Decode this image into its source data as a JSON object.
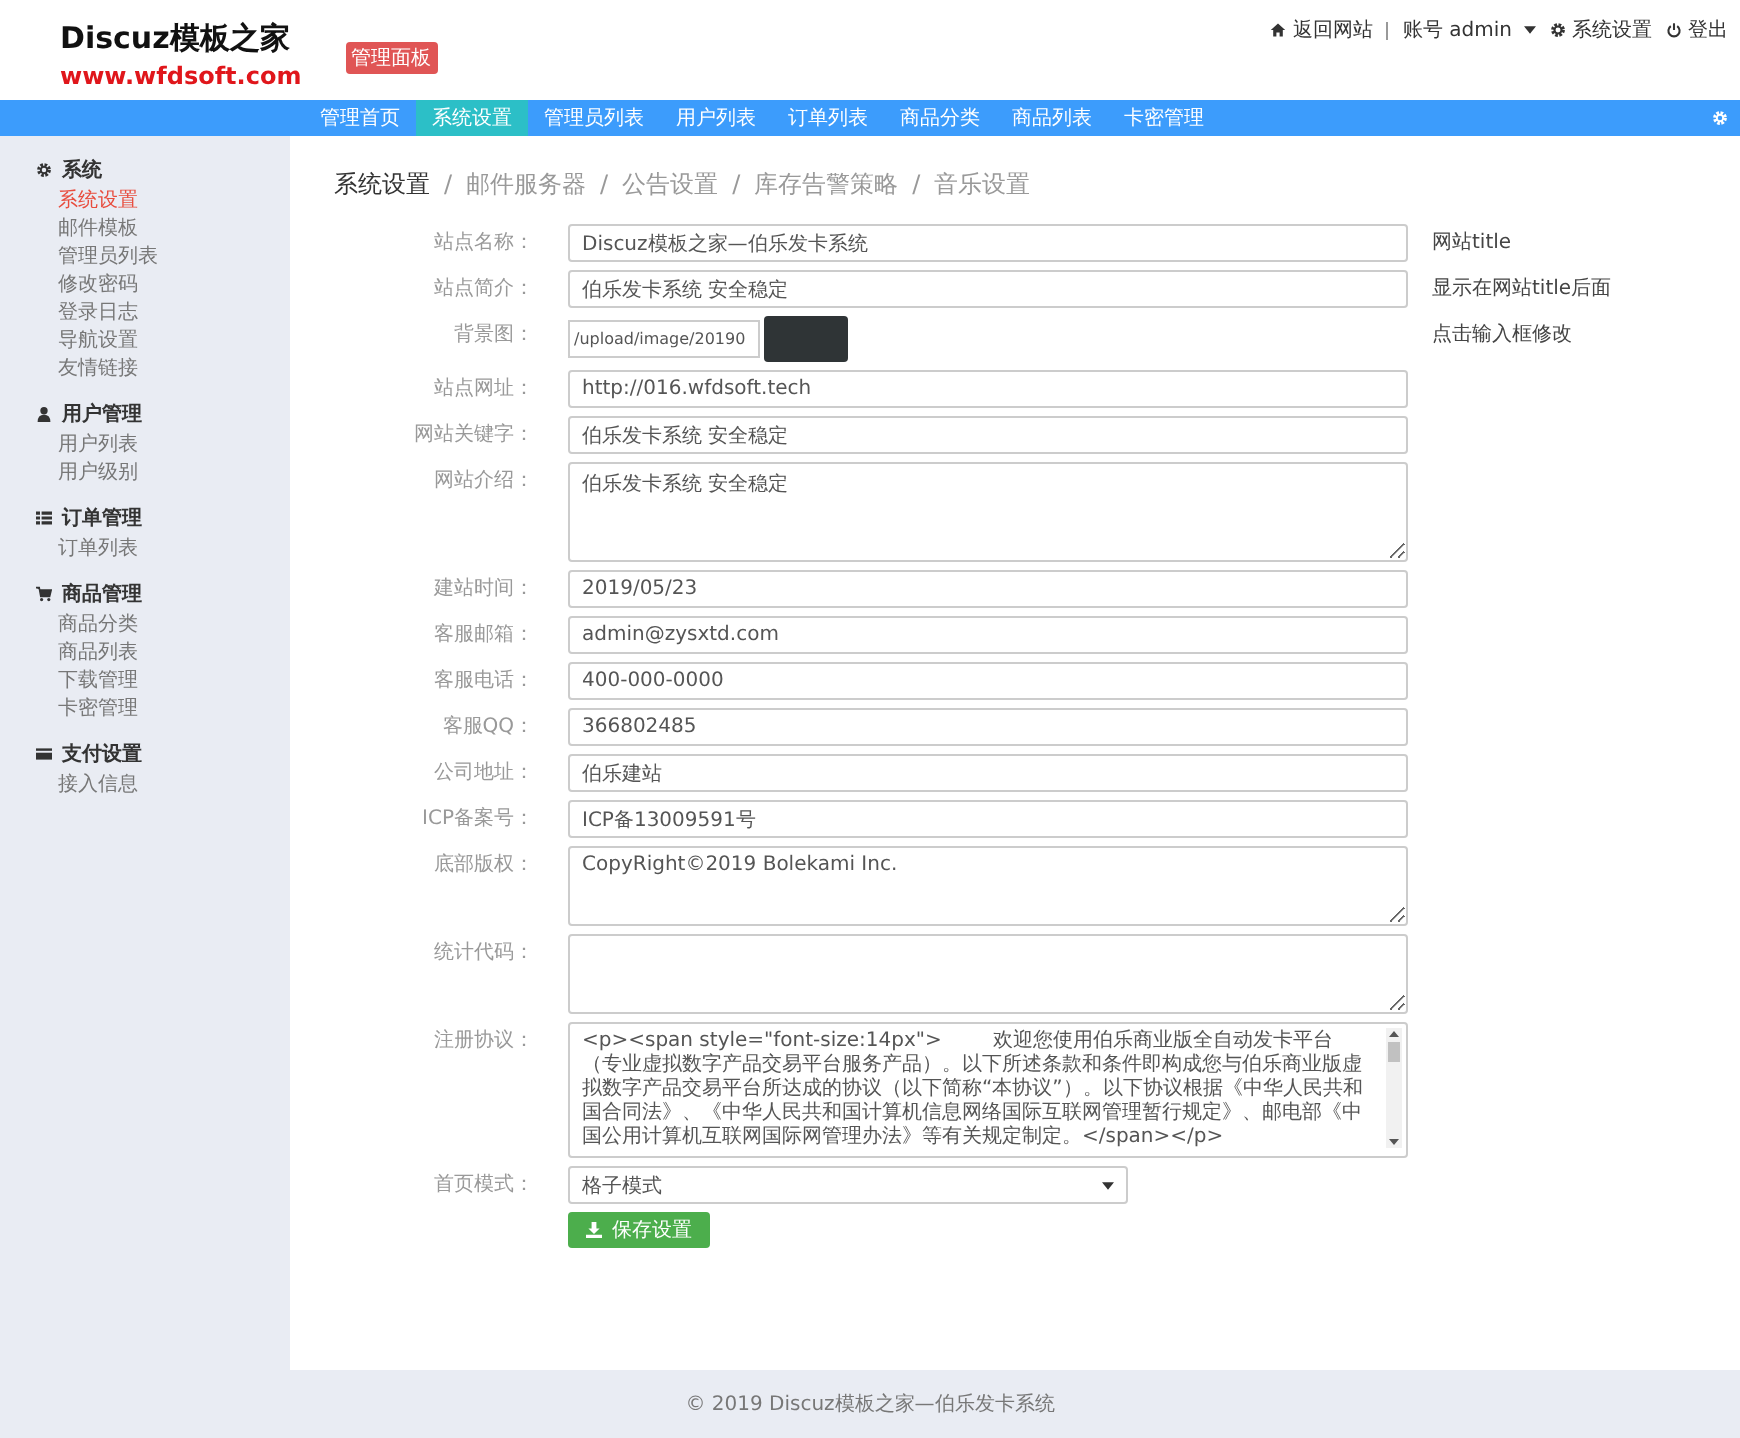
{
  "header": {
    "logo_title": "Discuz模板之家",
    "logo_url": "www.wfdsoft.com",
    "badge": "管理面板",
    "links": [
      {
        "label": "返回网站"
      },
      {
        "label": "账号 admin"
      },
      {
        "label": "系统设置"
      },
      {
        "label": "登出"
      }
    ]
  },
  "nav": [
    {
      "label": "管理首页",
      "selected": false
    },
    {
      "label": "系统设置",
      "selected": true
    },
    {
      "label": "管理员列表",
      "selected": false
    },
    {
      "label": "用户列表",
      "selected": false
    },
    {
      "label": "订单列表",
      "selected": false
    },
    {
      "label": "商品分类",
      "selected": false
    },
    {
      "label": "商品列表",
      "selected": false
    },
    {
      "label": "卡密管理",
      "selected": false
    }
  ],
  "sidebar": [
    {
      "title": "系统",
      "items": [
        {
          "label": "系统设置",
          "selected": true
        },
        {
          "label": "邮件模板",
          "selected": false
        },
        {
          "label": "管理员列表",
          "selected": false
        },
        {
          "label": "修改密码",
          "selected": false
        },
        {
          "label": "登录日志",
          "selected": false
        },
        {
          "label": "导航设置",
          "selected": false
        },
        {
          "label": "友情链接",
          "selected": false
        }
      ]
    },
    {
      "title": "用户管理",
      "items": [
        {
          "label": "用户列表",
          "selected": false
        },
        {
          "label": "用户级别",
          "selected": false
        }
      ]
    },
    {
      "title": "订单管理",
      "items": [
        {
          "label": "订单列表",
          "selected": false
        }
      ]
    },
    {
      "title": "商品管理",
      "items": [
        {
          "label": "商品分类",
          "selected": false
        },
        {
          "label": "商品列表",
          "selected": false
        },
        {
          "label": "下载管理",
          "selected": false
        },
        {
          "label": "卡密管理",
          "selected": false
        }
      ]
    },
    {
      "title": "支付设置",
      "items": [
        {
          "label": "接入信息",
          "selected": false
        }
      ]
    }
  ],
  "tabs": [
    {
      "label": "系统设置",
      "selected": true
    },
    {
      "label": "邮件服务器",
      "selected": false
    },
    {
      "label": "公告设置",
      "selected": false
    },
    {
      "label": "库存告警策略",
      "selected": false
    },
    {
      "label": "音乐设置",
      "selected": false
    }
  ],
  "form": [
    {
      "kind": "input",
      "label": "站点名称：",
      "value": "Discuz模板之家—伯乐发卡系统",
      "hint": "网站title"
    },
    {
      "kind": "input",
      "label": "站点简介：",
      "value": "伯乐发卡系统 安全稳定",
      "hint": "显示在网站title后面"
    },
    {
      "kind": "image",
      "label": "背景图：",
      "value": "/upload/image/20190",
      "hint": "点击输入框修改"
    },
    {
      "kind": "input",
      "label": "站点网址：",
      "value": "http://016.wfdsoft.tech"
    },
    {
      "kind": "input",
      "label": "网站关键字：",
      "value": "伯乐发卡系统 安全稳定"
    },
    {
      "kind": "textarea",
      "label": "网站介绍：",
      "value": "伯乐发卡系统 安全稳定"
    },
    {
      "kind": "input",
      "label": "建站时间：",
      "value": "2019/05/23"
    },
    {
      "kind": "input",
      "label": "客服邮箱：",
      "value": "admin@zysxtd.com"
    },
    {
      "kind": "input",
      "label": "客服电话：",
      "value": "400-000-0000"
    },
    {
      "kind": "input",
      "label": "客服QQ：",
      "value": "366802485"
    },
    {
      "kind": "input",
      "label": "公司地址：",
      "value": "伯乐建站"
    },
    {
      "kind": "input",
      "label": "ICP备案号：",
      "value": "ICP备13009591号"
    },
    {
      "kind": "textarea",
      "label": "底部版权：",
      "value": "CopyRight©2019 Bolekami Inc."
    },
    {
      "kind": "textarea",
      "label": "统计代码："
    },
    {
      "kind": "scrollarea",
      "label": "注册协议：",
      "value": "<p><span style=\"font-size:14px\">        欢迎您使用伯乐商业版全自动发卡平台（专业虚拟数字产品交易平台服务产品）。以下所述条款和条件即构成您与伯乐商业版虚拟数字产品交易平台所达成的协议（以下简称“本协议”）。以下协议根据《中华人民共和国合同法》、《中华人民共和国计算机信息网络国际互联网管理暂行规定》、邮电部《中国公用计算机互联网国际网管理办法》等有关规定制定。</span></p>"
    },
    {
      "kind": "select",
      "label": "首页模式：",
      "value": "格子模式"
    }
  ],
  "tab_separator": "/",
  "save_button": "保存设置",
  "footer": "©  2019 Discuz模板之家—伯乐发卡系统"
}
